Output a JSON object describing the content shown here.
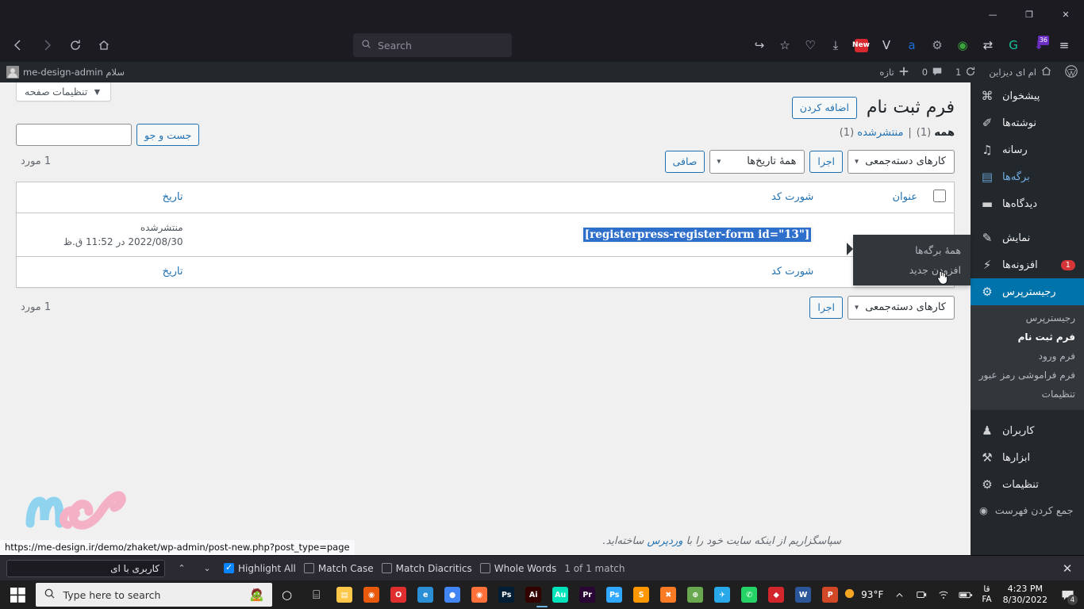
{
  "browser": {
    "window_controls": {
      "minimize": "—",
      "maximize": "❐",
      "close": "✕"
    },
    "nav": {
      "back": "back-arrow",
      "forward": "forward-arrow",
      "reload": "reload",
      "home": "home"
    },
    "search": {
      "placeholder": "Search",
      "icon": "search-icon"
    },
    "extensions": [
      {
        "name": "share-icon",
        "glyph": "↪",
        "color": "#c5c5ce"
      },
      {
        "name": "bookmark-star-icon",
        "glyph": "☆",
        "color": "#c5c5ce"
      },
      {
        "name": "pocket-icon",
        "glyph": "♡",
        "color": "#c5c5ce"
      },
      {
        "name": "downloads-icon",
        "glyph": "⤓",
        "color": "#c5c5ce"
      },
      {
        "name": "news-extension-icon",
        "glyph": "New",
        "color": "#d7282f"
      },
      {
        "name": "vpn-extension-icon",
        "glyph": "V",
        "color": "#cfcfd8"
      },
      {
        "name": "adblock-extension-icon",
        "glyph": "a",
        "color": "#1c6fd4"
      },
      {
        "name": "gears-extension-icon",
        "glyph": "⚙",
        "color": "#9aa0a6"
      },
      {
        "name": "idm-extension-icon",
        "glyph": "◉",
        "color": "#3aa33a"
      },
      {
        "name": "translate-extension-icon",
        "glyph": "⇄",
        "color": "#d5d5dd"
      },
      {
        "name": "grammarly-extension-icon",
        "glyph": "G",
        "color": "#15c39a"
      },
      {
        "name": "download-manager-icon",
        "glyph": "⬇",
        "color": "#6a2fc0",
        "badge": "36"
      },
      {
        "name": "app-menu-icon",
        "glyph": "≡",
        "color": "#d5d5dd"
      }
    ]
  },
  "adminbar": {
    "wp_logo": "wordpress-logo",
    "site_home_icon": "home-icon",
    "site_name": "ام ای دیزاین",
    "updates": {
      "icon": "updates-icon",
      "count": "1"
    },
    "comments": {
      "icon": "comments-icon",
      "count": "0"
    },
    "new_content": {
      "icon": "plus-icon",
      "label": "تازه"
    },
    "account": {
      "greeting": "سلام me-design-admin",
      "avatar": "user-avatar"
    }
  },
  "adminmenu": {
    "items": [
      {
        "label": "پیشخوان",
        "icon": "dashboard-icon",
        "glyph": "⌘",
        "state": "normal"
      },
      {
        "label": "نوشته‌ها",
        "icon": "posts-pin-icon",
        "glyph": "✐",
        "state": "normal"
      },
      {
        "label": "رسانه",
        "icon": "media-icon",
        "glyph": "♫",
        "state": "normal"
      },
      {
        "label": "برگه‌ها",
        "icon": "pages-icon",
        "glyph": "▤",
        "state": "hover"
      },
      {
        "label": "دیدگاه‌ها",
        "icon": "comments-icon",
        "glyph": "▬",
        "state": "normal"
      },
      {
        "label": "نمایش",
        "icon": "appearance-brush-icon",
        "glyph": "✎",
        "state": "normal",
        "separator_before": true
      },
      {
        "label": "افزونه‌ها",
        "icon": "plugins-plug-icon",
        "glyph": "⚡",
        "state": "normal",
        "badge": "1"
      },
      {
        "label": "رجیسترپرس",
        "icon": "registerpress-lock-icon",
        "glyph": "⚙",
        "state": "current"
      },
      {
        "label": "کاربران",
        "icon": "users-icon",
        "glyph": "♟",
        "state": "normal",
        "separator_before": true
      },
      {
        "label": "ابزارها",
        "icon": "tools-wrench-icon",
        "glyph": "⚒",
        "state": "normal"
      },
      {
        "label": "تنظیمات",
        "icon": "settings-sliders-icon",
        "glyph": "⚙",
        "state": "normal"
      }
    ],
    "submenu": [
      {
        "label": "رجیسترپرس",
        "current": false
      },
      {
        "label": "فرم ثبت نام",
        "current": true
      },
      {
        "label": "فرم ورود",
        "current": false
      },
      {
        "label": "فرم فراموشی رمز عبور",
        "current": false
      },
      {
        "label": "تنظیمات",
        "current": false
      }
    ],
    "collapse": {
      "label": "جمع کردن فهرست",
      "icon": "collapse-arrow-icon",
      "glyph": "◉"
    }
  },
  "pages_flyout": {
    "items": [
      {
        "label": "همهٔ برگه‌ها"
      },
      {
        "label": "افزودن جدید"
      }
    ],
    "cursor": "pointer-hand-cursor"
  },
  "screen_meta": {
    "screen_options_label": "تنظیمات صفحه",
    "caret": "▼"
  },
  "page": {
    "title": "فرم ثبت نام",
    "add_new_label": "اضافه کردن",
    "views": {
      "all_label": "همه",
      "all_count": "(1)",
      "separator": "|",
      "published_label": "منتشرشده",
      "published_count": "(1)"
    },
    "search": {
      "button_label": "جست و جو",
      "value": "",
      "placeholder": ""
    },
    "tablenav_top": {
      "bulk_actions_label": "کارهای دسته‌جمعی",
      "apply_label": "اجرا",
      "date_filter_label": "همهٔ تاریخ‌ها",
      "filter_label": "صافی",
      "caret": "⌄"
    },
    "tablenav_bottom": {
      "bulk_actions_label": "کارهای دسته‌جمعی",
      "apply_label": "اجرا",
      "caret": "⌄"
    },
    "displaying_num_top": "1 مورد",
    "displaying_num_bottom": "1 مورد",
    "table": {
      "columns": {
        "checkbox": "select-all-checkbox",
        "title": "عنوان",
        "shortcode": "شورت کد",
        "date": "تاریخ"
      },
      "rows": [
        {
          "title": "",
          "shortcode": "[registerpress-register-form id=\"13\"]",
          "shortcode_selected": true,
          "date_status": "منتشرشده",
          "date_value": "2022/08/30 در 11:52 ق.ظ"
        }
      ]
    },
    "footer": {
      "thanks_prefix": "سپاسگزاریم از اینکه سایت خود را با ",
      "link_label": "وردپرس",
      "thanks_suffix": " ساخته‌اید."
    },
    "logo_text": "me"
  },
  "status_bar": {
    "url": "https://me-design.ir/demo/zhaket/wp-admin/post-new.php?post_type=page"
  },
  "findbar": {
    "query": "کاربری با ای",
    "prev_icon": "⌃",
    "next_icon": "⌄",
    "highlight_all": {
      "label": "Highlight All",
      "checked": true
    },
    "match_case": {
      "label": "Match Case",
      "checked": false
    },
    "match_diacritics": {
      "label": "Match Diacritics",
      "checked": false
    },
    "whole_words": {
      "label": "Whole Words",
      "checked": false
    },
    "status": "1 of 1 match",
    "close_icon": "✕"
  },
  "taskbar": {
    "start": "windows-start-icon",
    "search_placeholder": "Type here to search",
    "cortana_icon": "○",
    "taskview_icon": "⌸",
    "apps": [
      {
        "name": "file-explorer",
        "glyph": "▤",
        "color": "#ffc84a"
      },
      {
        "name": "firefox-browser",
        "glyph": "◉",
        "color": "#e8590c"
      },
      {
        "name": "opera-browser",
        "glyph": "O",
        "color": "#e02d2d"
      },
      {
        "name": "edge-browser",
        "glyph": "e",
        "color": "#2a8fd4"
      },
      {
        "name": "chrome-browser",
        "glyph": "●",
        "color": "#4285f4"
      },
      {
        "name": "firefox-active",
        "glyph": "◉",
        "color": "#ff7139",
        "active": true
      },
      {
        "name": "photoshop",
        "glyph": "Ps",
        "color": "#001e36"
      },
      {
        "name": "illustrator",
        "glyph": "Ai",
        "color": "#330000"
      },
      {
        "name": "audition",
        "glyph": "Au",
        "color": "#00e4bb"
      },
      {
        "name": "premiere",
        "glyph": "Pr",
        "color": "#2a0634"
      },
      {
        "name": "photoshop-2",
        "glyph": "Ps",
        "color": "#31a8ff"
      },
      {
        "name": "sublime-text",
        "glyph": "S",
        "color": "#ff9800"
      },
      {
        "name": "xampp",
        "glyph": "✖",
        "color": "#fb7a24"
      },
      {
        "name": "browser-globe",
        "glyph": "⊕",
        "color": "#6aa84f"
      },
      {
        "name": "telegram",
        "glyph": "✈",
        "color": "#29a9ea"
      },
      {
        "name": "whatsapp",
        "glyph": "✆",
        "color": "#25d366"
      },
      {
        "name": "acrobat-reader",
        "glyph": "◆",
        "color": "#d3262c"
      },
      {
        "name": "word",
        "glyph": "W",
        "color": "#2b579a"
      },
      {
        "name": "powerpoint",
        "glyph": "P",
        "color": "#d24726"
      }
    ],
    "tray": {
      "weather_temp": "93°F",
      "weather_icon": "sun-icon",
      "chevron_icon": "⌃",
      "onedrive_icon": "☁",
      "network_icon": "ᴴ",
      "battery_icon": "▭",
      "language_top": "قا",
      "language_bottom": "FA",
      "time": "4:23 PM",
      "date": "8/30/2022",
      "notification_count": "4"
    }
  }
}
